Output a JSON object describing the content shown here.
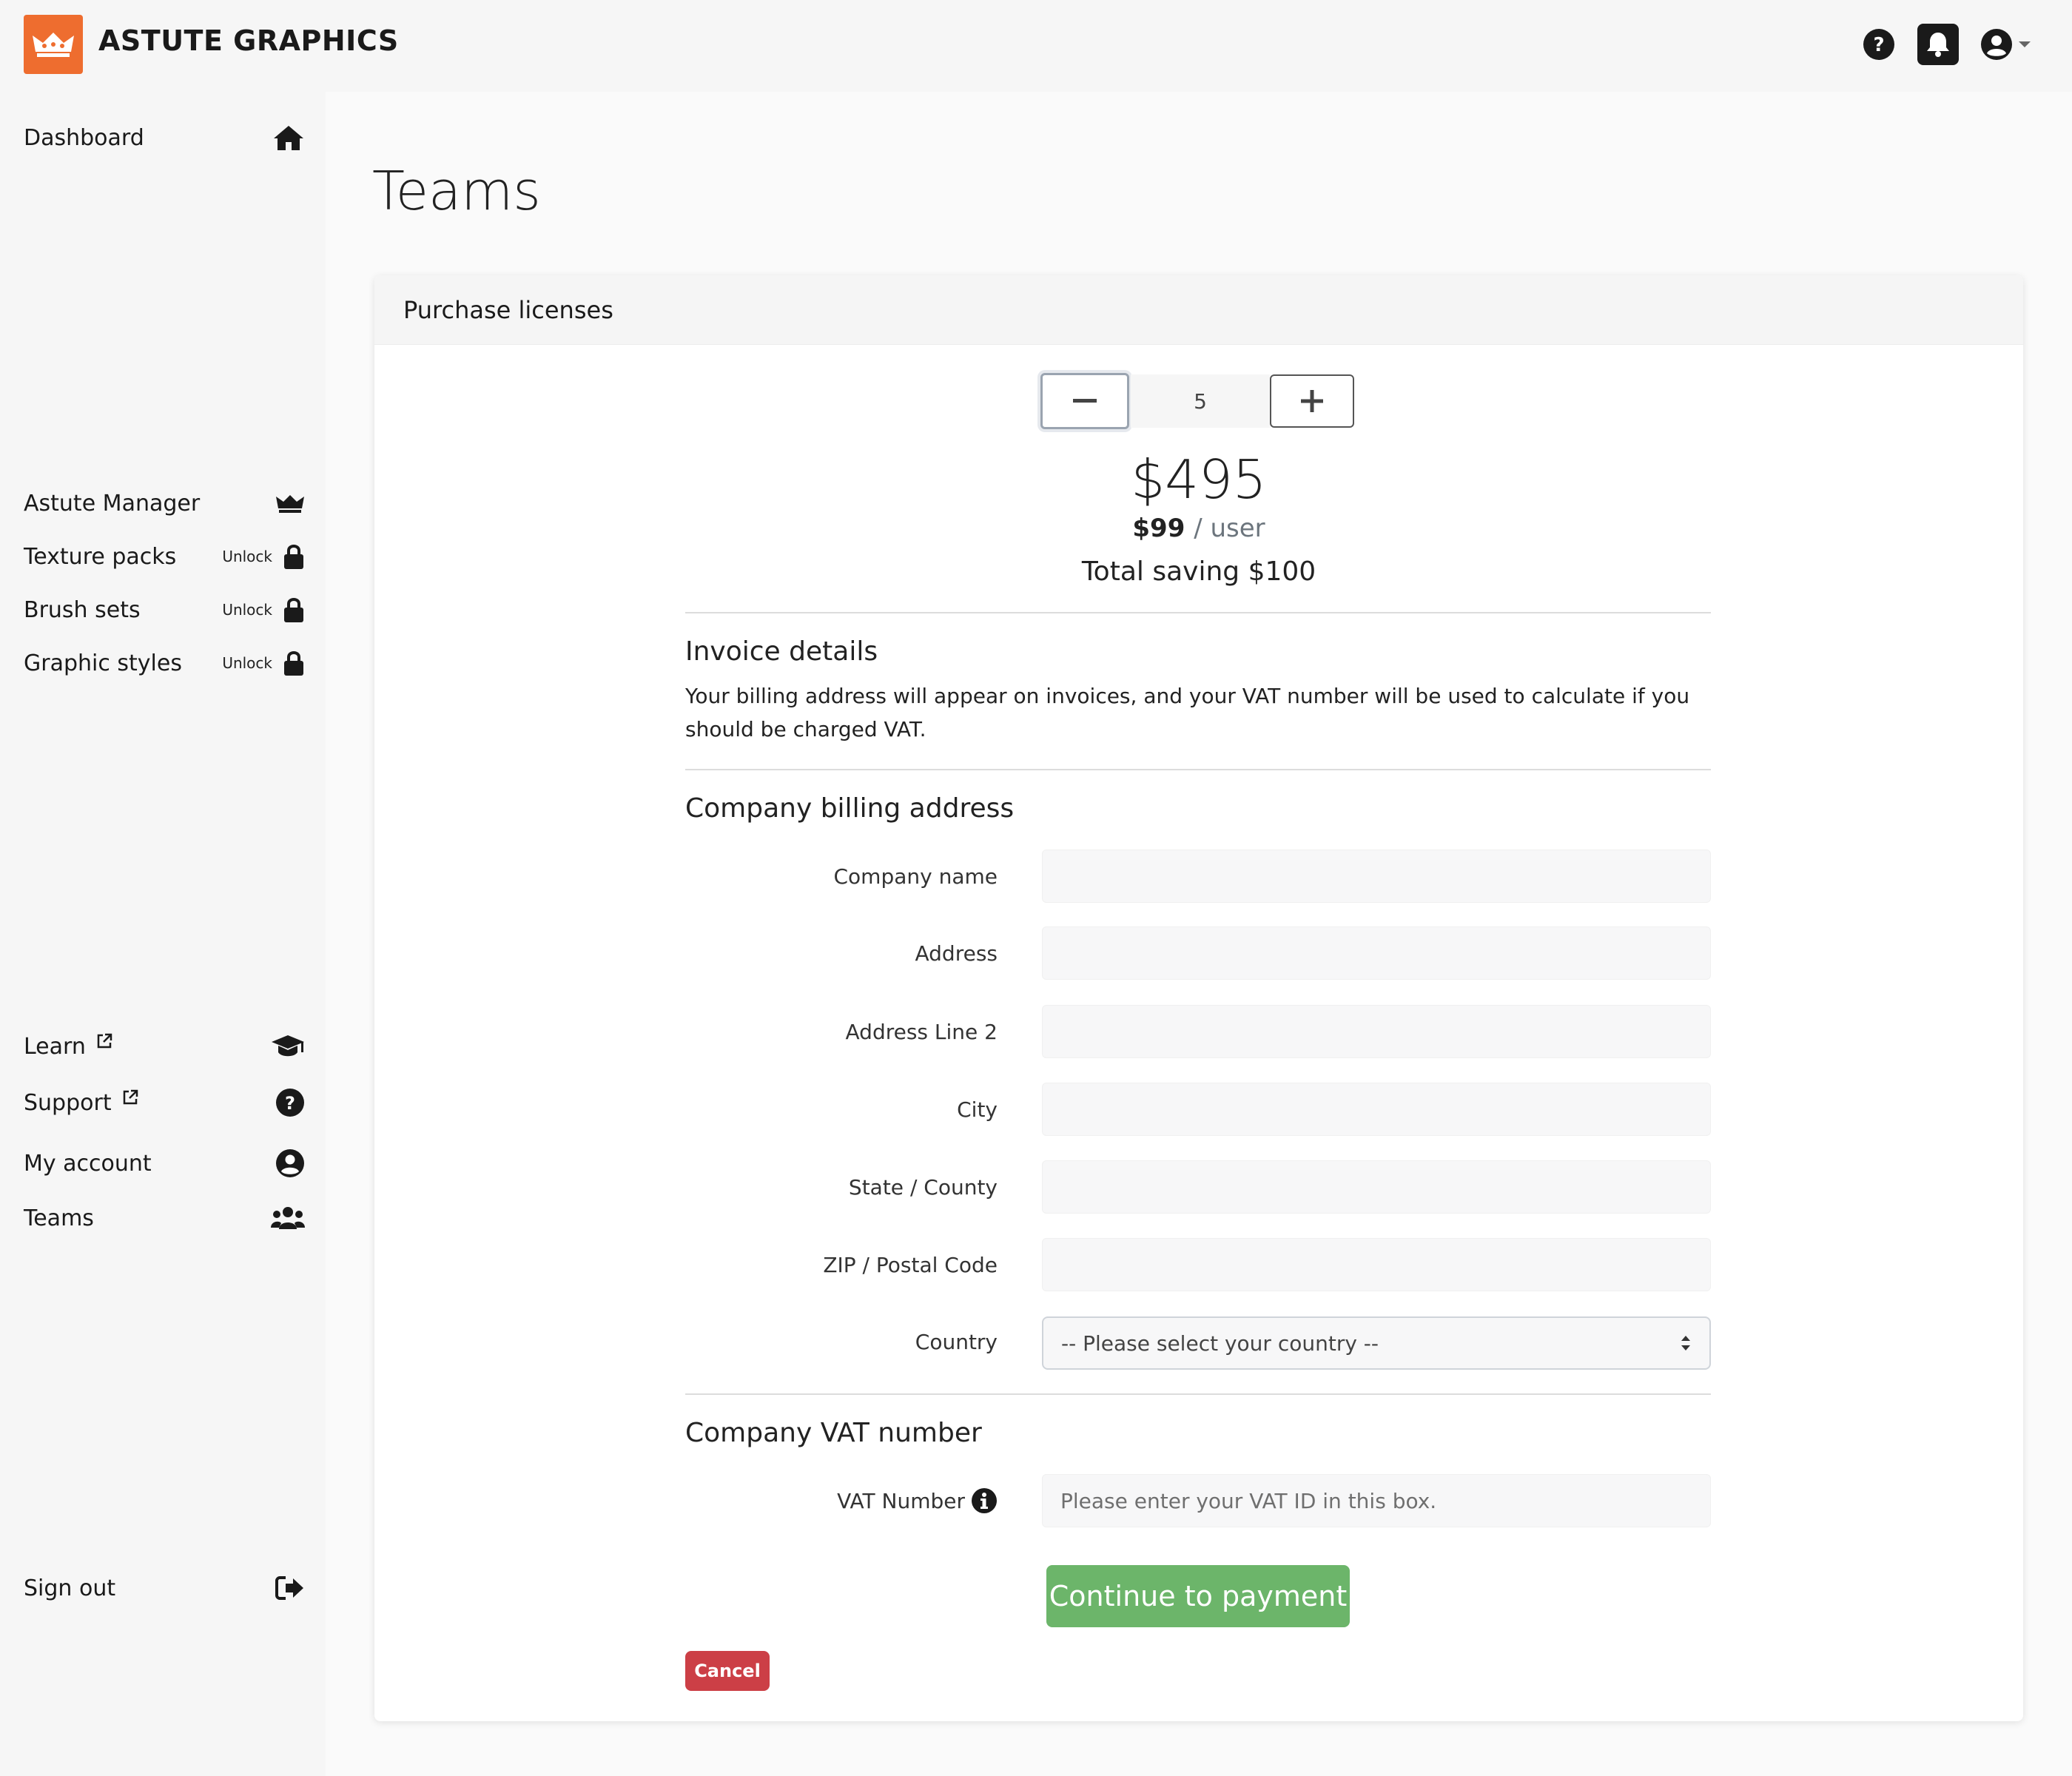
{
  "brand": {
    "name": "ASTUTE GRAPHICS",
    "accent": "#ee6d2f"
  },
  "topbar": {
    "icons": [
      "help-icon",
      "bell-icon",
      "user-circle-icon",
      "caret-down-icon"
    ]
  },
  "sidebar": {
    "dashboard": "Dashboard",
    "astute_manager": "Astute Manager",
    "texture_packs": "Texture packs",
    "brush_sets": "Brush sets",
    "graphic_styles": "Graphic styles",
    "unlock_label": "Unlock",
    "learn": "Learn",
    "support": "Support",
    "my_account": "My account",
    "teams": "Teams",
    "sign_out": "Sign out"
  },
  "main": {
    "page_title": "Teams",
    "card_title": "Purchase licenses",
    "quantity": "5",
    "total_price": "$495",
    "per_user_price": "$99",
    "per_user_suffix": "/ user",
    "saving": "Total saving $100",
    "invoice": {
      "title": "Invoice details",
      "description": "Your billing address will appear on invoices, and your VAT number will be used to calculate if you should be charged VAT."
    },
    "billing": {
      "title": "Company billing address",
      "company_name": "Company name",
      "address": "Address",
      "address2": "Address Line 2",
      "city": "City",
      "state": "State / County",
      "zip": "ZIP / Postal Code",
      "country": "Country",
      "country_placeholder": "-- Please select your country --"
    },
    "vat": {
      "title": "Company VAT number",
      "label": "VAT Number",
      "placeholder": "Please enter your VAT ID in this box."
    },
    "continue_button": "Continue to payment",
    "cancel_button": "Cancel"
  },
  "colors": {
    "success": "#6cb56a",
    "danger": "#cc3f46"
  }
}
